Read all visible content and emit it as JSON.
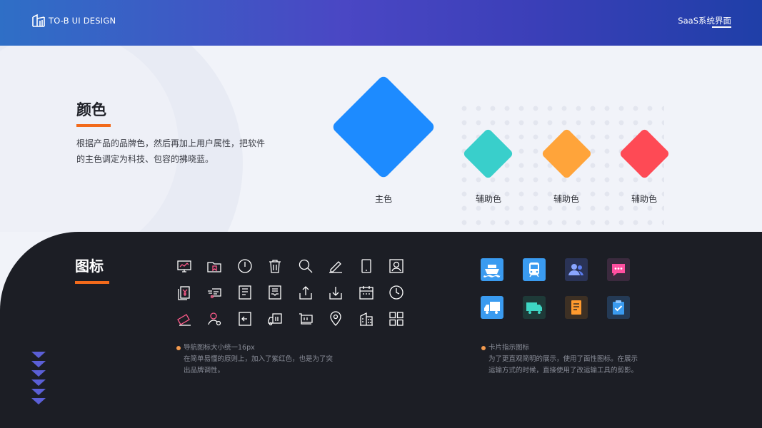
{
  "header": {
    "logo_text": "TO-B UI DESIGN",
    "right_label": "SaaS系统界面"
  },
  "colors_section": {
    "title": "颜色",
    "description": "根据产品的品牌色，然后再加上用户属性，把软件的主色调定为科技、包容的拂晓蓝。",
    "swatches": [
      {
        "label": "主色",
        "color": "#1d8bff"
      },
      {
        "label": "辅助色",
        "color": "#39cfcb"
      },
      {
        "label": "辅助色",
        "color": "#ffa43a"
      },
      {
        "label": "辅助色",
        "color": "#fe4a55"
      }
    ]
  },
  "icons_section": {
    "title": "图标",
    "line_icons": [
      "monitor-chart-icon",
      "folder-bookmark-icon",
      "power-icon",
      "trash-icon",
      "search-icon",
      "edit-icon",
      "mobile-icon",
      "user-card-icon",
      "yuan-document-icon",
      "fast-delivery-icon",
      "bookmark-document-icon",
      "inbox-document-icon",
      "upload-icon",
      "download-icon",
      "calendar-icon",
      "clock-icon",
      "ticket-icon",
      "user-pin-icon",
      "exit-icon",
      "truck-box-icon",
      "cart-frame-icon",
      "location-icon",
      "building-icon",
      "grid-icon"
    ],
    "card_icons": [
      {
        "name": "ship-icon",
        "bg": "#3a9bf0"
      },
      {
        "name": "train-icon",
        "bg": "#3a9bf0"
      },
      {
        "name": "users-icon",
        "bg": "#2a3356"
      },
      {
        "name": "message-icon",
        "bg": "#3b2a3e"
      },
      {
        "name": "truck-icon",
        "bg": "#3a9bf0"
      },
      {
        "name": "van-icon",
        "bg": "#1e3a38"
      },
      {
        "name": "document-icon",
        "bg": "#3d3024"
      },
      {
        "name": "clipboard-check-icon",
        "bg": "#243a55"
      }
    ],
    "note_left_title": "导航图标大小统一16px",
    "note_left_body": "在简单易懂的原则上，加入了紫红色，也是为了突出品牌调性。",
    "note_right_title": "卡片指示图标",
    "note_right_body": "为了更直观简明的展示，使用了面性图标。在展示运输方式的时候，直接使用了改运输工具的剪影。"
  }
}
